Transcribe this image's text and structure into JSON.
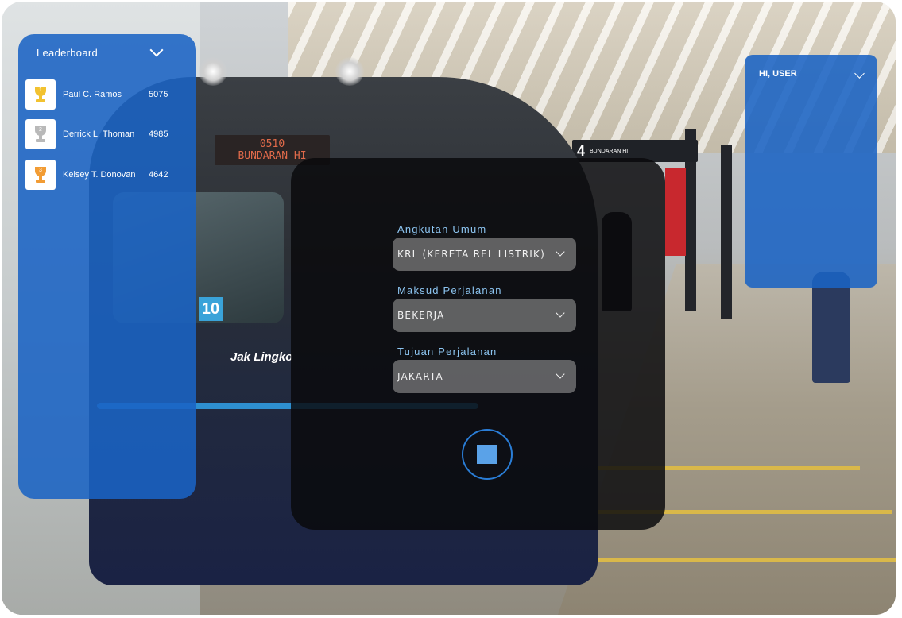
{
  "leaderboard": {
    "title": "Leaderboard",
    "entries": [
      {
        "rank": "1",
        "name": "Paul C. Ramos",
        "score": "5075",
        "medal": "gold",
        "color": "#f2c230"
      },
      {
        "rank": "2",
        "name": "Derrick L. Thoman",
        "score": "4985",
        "medal": "silver",
        "color": "#b9b9b9"
      },
      {
        "rank": "3",
        "name": "Kelsey T. Donovan",
        "score": "4642",
        "medal": "bronze",
        "color": "#f29c34"
      }
    ]
  },
  "user_panel": {
    "title": "HI, USER"
  },
  "form": {
    "transport": {
      "label": "Angkutan Umum",
      "value": "KRL (KERETA REL LISTRIK)"
    },
    "purpose": {
      "label": "Maksud Perjalanan",
      "value": "BEKERJA"
    },
    "destination": {
      "label": "Tujuan Perjalanan",
      "value": "JAKARTA"
    }
  },
  "background_scene": {
    "train_display_line1": "0510",
    "train_display_line2": "BUNDARAN HI",
    "train_number": "10",
    "train_logo": "Jak Lingko",
    "platform_sign_number": "4",
    "platform_sign_text": "BUNDARAN HI"
  },
  "colors": {
    "panel_blue": "#1a63c4",
    "accent_blue": "#5aa2e8",
    "label_blue": "#8cc4f0",
    "dark_panel": "#0a0a0c"
  }
}
